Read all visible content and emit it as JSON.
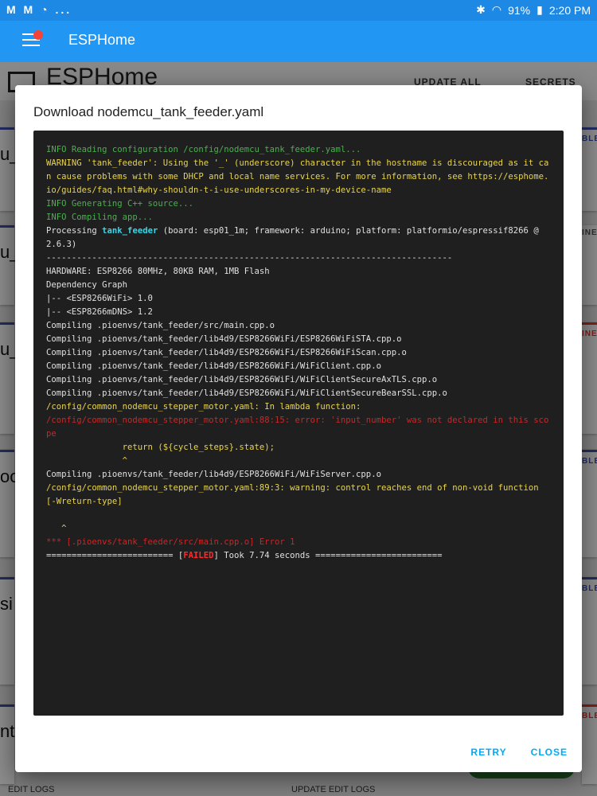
{
  "status_bar": {
    "left_icons": "M M ◔ ...",
    "battery": "91%",
    "time": "2:20 PM"
  },
  "app_bar": {
    "title": "ESPHome"
  },
  "page": {
    "brand": "ESPHome",
    "update_all": "UPDATE ALL",
    "secrets": "SECRETS",
    "cards": [
      {
        "title": "u_",
        "badge": "BLE",
        "footer": "E"
      },
      {
        "title": "u_",
        "badge": "INE",
        "footer": "E"
      },
      {
        "title": "u_",
        "badge": "INE",
        "footer": "E"
      },
      {
        "title": "oo",
        "badge": "BLE",
        "footer": "E"
      },
      {
        "title": "si",
        "badge": "BLE",
        "footer": "E"
      },
      {
        "title": "nt",
        "badge": "BLE",
        "footer": "E"
      }
    ],
    "bottom_left": "EDIT    LOGS",
    "bottom_right": "UPDATE   EDIT    LOGS"
  },
  "dialog": {
    "title": "Download nodemcu_tank_feeder.yaml",
    "retry": "RETRY",
    "close": "CLOSE"
  },
  "console": {
    "l1": "INFO Reading configuration /config/nodemcu_tank_feeder.yaml...",
    "l2": "WARNING 'tank_feeder': Using the '_' (underscore) character in the hostname is discouraged as it can cause problems with some DHCP and local name services. For more information, see https://esphome.io/guides/faq.html#why-shouldn-t-i-use-underscores-in-my-device-name",
    "l3": "INFO Generating C++ source...",
    "l4": "INFO Compiling app...",
    "l5a": "Processing ",
    "l5b": "tank_feeder",
    "l5c": " (board: esp01_1m; framework: arduino; platform: platformio/espressif8266 @ 2.6.3)",
    "l6": "--------------------------------------------------------------------------------",
    "l7": "HARDWARE: ESP8266 80MHz, 80KB RAM, 1MB Flash",
    "l8": "Dependency Graph",
    "l9": "|-- <ESP8266WiFi> 1.0",
    "l10": "|-- <ESP8266mDNS> 1.2",
    "l11": "Compiling .pioenvs/tank_feeder/src/main.cpp.o",
    "l12": "Compiling .pioenvs/tank_feeder/lib4d9/ESP8266WiFi/ESP8266WiFiSTA.cpp.o",
    "l13": "Compiling .pioenvs/tank_feeder/lib4d9/ESP8266WiFi/ESP8266WiFiScan.cpp.o",
    "l14": "Compiling .pioenvs/tank_feeder/lib4d9/ESP8266WiFi/WiFiClient.cpp.o",
    "l15": "Compiling .pioenvs/tank_feeder/lib4d9/ESP8266WiFi/WiFiClientSecureAxTLS.cpp.o",
    "l16": "Compiling .pioenvs/tank_feeder/lib4d9/ESP8266WiFi/WiFiClientSecureBearSSL.cpp.o",
    "l17": "/config/common_nodemcu_stepper_motor.yaml: In lambda function:",
    "l18": "/config/common_nodemcu_stepper_motor.yaml:88:15: error: 'input_number' was not declared in this scope",
    "l19": "               return (${cycle_steps}.state);",
    "l20": "               ^",
    "l21": "Compiling .pioenvs/tank_feeder/lib4d9/ESP8266WiFi/WiFiServer.cpp.o",
    "l22": "/config/common_nodemcu_stepper_motor.yaml:89:3: warning: control reaches end of non-void function [-Wreturn-type]",
    "l23": " ",
    "l24": "   ^",
    "l25": "*** [.pioenvs/tank_feeder/src/main.cpp.o] Error 1",
    "l26a": "========================= [",
    "l26b": "FAILED",
    "l26c": "] Took 7.74 seconds ========================="
  },
  "colors": {
    "app_bar": "#2196f3",
    "status_bar": "#1e88e5",
    "console_bg": "#1f1f1f",
    "accent": "#03a9f4"
  }
}
